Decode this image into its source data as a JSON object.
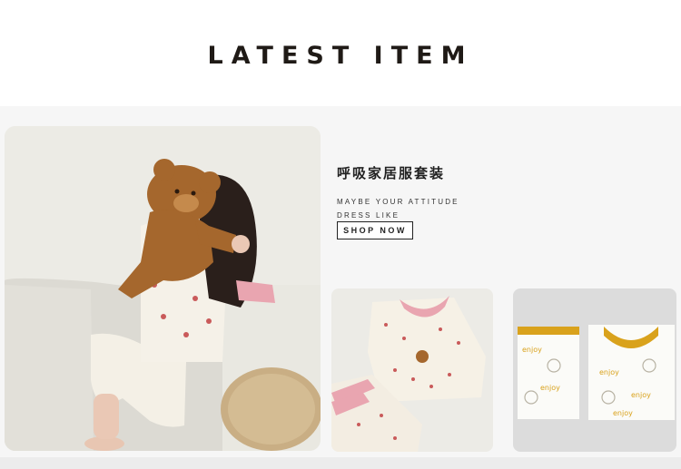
{
  "section": {
    "title": "LATEST ITEM"
  },
  "feature": {
    "name": "呼吸家居服套装",
    "tagline": "MAYBE YOUR ATTITUDE\nDRESS LIKE",
    "cta_label": "SHOP NOW"
  },
  "photos": {
    "main": {
      "icon": "child-with-teddy-bear-photo"
    },
    "pink": {
      "icon": "pink-trim-pajama-set-photo"
    },
    "yellow": {
      "icon": "yellow-trim-pajama-set-photo"
    }
  },
  "colors": {
    "accent_pink": "#e9a5b0",
    "accent_yellow": "#d9a21c",
    "text_dark": "#1f1a16"
  }
}
